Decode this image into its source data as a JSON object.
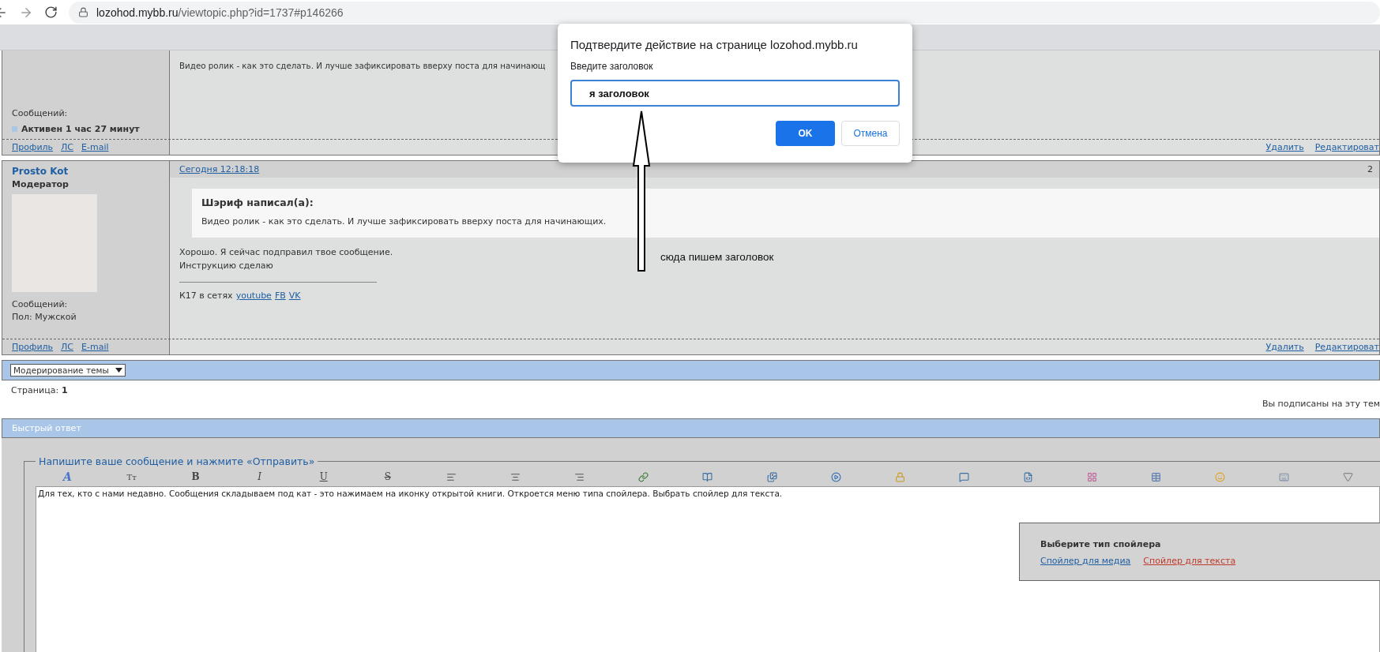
{
  "browser": {
    "url_host": "lozohod.mybb.ru",
    "url_path": "/viewtopic.php?id=1737#p146266"
  },
  "previous_post": {
    "text": "Видео ролик - как это сделать. И лучше зафиксировать вверху поста для начинающ",
    "stats": [
      "Сообщений:"
    ],
    "activity": "Активен 1 час 27 минут",
    "links": [
      "Профиль",
      "ЛС",
      "E-mail"
    ],
    "actions": [
      "Удалить",
      "Редактироват"
    ]
  },
  "post": {
    "author": "Prosto Kot",
    "role": "Модератор",
    "date": "Сегодня 12:18:18",
    "number": "2",
    "quote": {
      "title": "Шэриф написал(а):",
      "text": "Видео ролик - как это сделать. И лучше зафиксировать вверху поста для начинающих."
    },
    "lines": [
      "Хорошо. Я сейчас подправил твое сообщение.",
      "Инструкцию сделаю"
    ],
    "signature": {
      "text": "К17 в сетях",
      "links": [
        "youtube",
        "FB",
        "VK"
      ]
    },
    "stats": [
      "Сообщений:",
      "Пол: Мужской"
    ],
    "links": [
      "Профиль",
      "ЛС",
      "E-mail"
    ],
    "actions": [
      "Удалить",
      "Редактироват"
    ]
  },
  "moderation_select": {
    "value": "Модерирование темы"
  },
  "pages": {
    "label": "Страница:",
    "current": "1"
  },
  "subscription": "Вы подписаны на эту тем",
  "quick_reply": {
    "title": "Быстрый ответ",
    "legend": "Напишите ваше сообщение и нажмите «Отправить»",
    "toolbar": [
      {
        "kind": "glyph",
        "label": "A"
      },
      {
        "kind": "glyph",
        "label": "Tт"
      },
      {
        "kind": "glyph",
        "label": "B"
      },
      {
        "kind": "glyph",
        "label": "I"
      },
      {
        "kind": "glyph",
        "label": "U"
      },
      {
        "kind": "glyph",
        "label": "S"
      },
      {
        "kind": "icon"
      },
      {
        "kind": "icon"
      },
      {
        "kind": "icon"
      },
      {
        "kind": "icon"
      },
      {
        "kind": "icon"
      },
      {
        "kind": "icon"
      },
      {
        "kind": "icon"
      },
      {
        "kind": "icon"
      },
      {
        "kind": "icon"
      },
      {
        "kind": "icon"
      },
      {
        "kind": "icon"
      },
      {
        "kind": "icon"
      },
      {
        "kind": "icon"
      },
      {
        "kind": "icon"
      },
      {
        "kind": "icon"
      }
    ],
    "message": "Для тех, кто с нами недавно. Сообщения складываем под кат - это нажимаем на иконку открытой книги. Откроется меню типа спойлера. Выбрать спойлер для текста.",
    "spoiler_menu": {
      "title": "Выберите тип спойлера",
      "options": [
        {
          "label": "Спойлер для медиа",
          "selected": false
        },
        {
          "label": "Спойлер для текста",
          "selected": true
        }
      ]
    }
  },
  "dialog": {
    "title": "Подтвердите действие на странице lozohod.mybb.ru",
    "prompt": "Введите заголовок",
    "value": "я заголовок",
    "buttons": [
      {
        "label": "OK",
        "kind": "primary"
      },
      {
        "label": "Отмена",
        "kind": "secondary"
      }
    ]
  },
  "annotation": {
    "text": "сюда пишем заголовок"
  }
}
